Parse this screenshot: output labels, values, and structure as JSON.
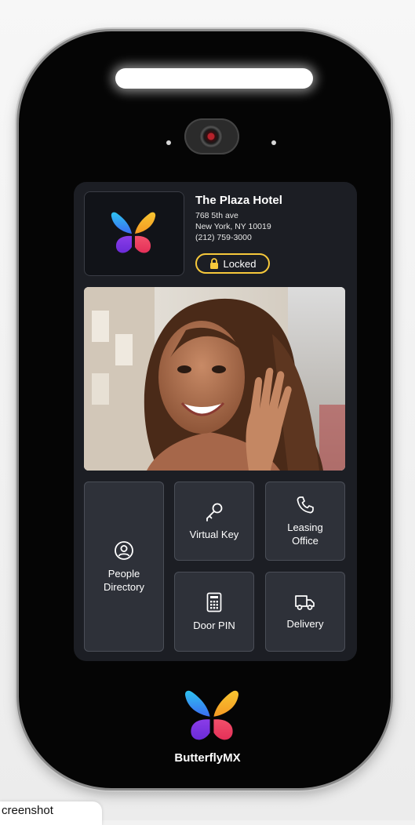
{
  "building": {
    "name": "The Plaza Hotel",
    "address_line1": "768 5th ave",
    "address_line2": "New York, NY 10019",
    "phone": "(212) 759-3000",
    "status": "Locked"
  },
  "actions": {
    "people_directory": "People\nDirectory",
    "virtual_key": "Virtual Key",
    "leasing_office": "Leasing\nOffice",
    "door_pin": "Door PIN",
    "delivery": "Delivery"
  },
  "brand": {
    "name": "ButterflyMX"
  },
  "caption": "creenshot",
  "colors": {
    "device": "#050505",
    "screen": "#1c1e24",
    "button": "#2e3139",
    "locked_accent": "#f6c83b"
  },
  "icons": [
    "butterfly-logo-icon",
    "lock-icon",
    "person-icon",
    "key-icon",
    "phone-icon",
    "keypad-icon",
    "truck-icon",
    "camera-icon"
  ]
}
